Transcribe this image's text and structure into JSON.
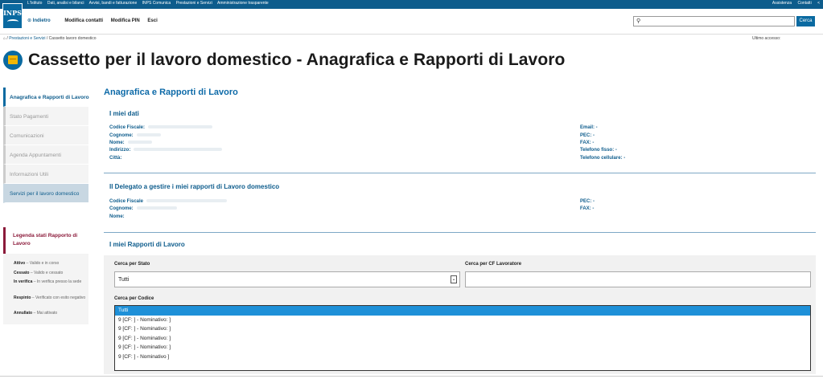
{
  "topbar": {
    "links": [
      "L'Istituto",
      "Dati, analisi e bilanci",
      "Avvisi, bandi e fatturazione",
      "INPS Comunica",
      "Prestazioni e Servizi",
      "Amministrazione trasparente"
    ],
    "right": [
      "Assistenza",
      "Contatti"
    ],
    "logo": "INPS"
  },
  "nav": {
    "back": "Indietro",
    "items": [
      "Modifica contatti",
      "Modifica PIN",
      "Esci"
    ],
    "search_button": "Cerca"
  },
  "breadcrumb": [
    "Prestazioni e Servizi",
    "Cassetto lavoro domestico"
  ],
  "last_access": "Ultimo accesso:",
  "page_title": "Cassetto per il lavoro domestico - Anagrafica e Rapporti di Lavoro",
  "sidebar": {
    "items": [
      "Anagrafica e Rapporti di Lavoro",
      "Stato Pagamenti",
      "Comunicazioni",
      "Agenda Appuntamenti",
      "Informazioni Utili",
      "Servizi per il lavoro domestico"
    ]
  },
  "legend": {
    "title": "Legenda stati Rapporto di Lavoro",
    "rows": [
      {
        "state": "Attivo",
        "desc": " – Valido e in corso"
      },
      {
        "state": "Cessato",
        "desc": " – Valido e cessato"
      },
      {
        "state": "In verifica",
        "desc": " – In verifica presso la sede"
      },
      {
        "state": "Respinto",
        "desc": " – Verificato con esito negativo"
      },
      {
        "state": "Annullato",
        "desc": " – Mai attivato"
      }
    ]
  },
  "main": {
    "title": "Anagrafica e Rapporti di Lavoro",
    "my_data": {
      "title": "I miei dati",
      "left": [
        "Codice Fiscale:",
        "Cognome:",
        "Nome:",
        "Indirizzo:",
        "Città:"
      ],
      "right": [
        "Email: -",
        "PEC: -",
        "FAX: -",
        "Telefono fisso: -",
        "Telefono cellulare: -"
      ]
    },
    "delegate": {
      "title": "Il Delegato a gestire i miei rapporti di Lavoro domestico",
      "left": [
        "Codice Fiscale",
        "Cognome:",
        "Nome:"
      ],
      "right": [
        "PEC: -",
        "FAX: -"
      ]
    },
    "relations": {
      "title": "I miei Rapporti di Lavoro",
      "search_state_label": "Cerca per Stato",
      "search_state_value": "Tutti",
      "search_cf_label": "Cerca per CF Lavoratore",
      "search_code_label": "Cerca per Codice",
      "code_options": [
        "Tutti",
        "9          [CF:                         ] - Nominativo:                    ]",
        "9          [CF:                         ]  - Nominativo:                   ]",
        "9          [CF:                         ]  - Nominativo:             ]",
        "9          [CF:                         ]  - Nominativo:             ]",
        "9          [CF:                         ]  - Nominativo                    ]"
      ]
    }
  }
}
